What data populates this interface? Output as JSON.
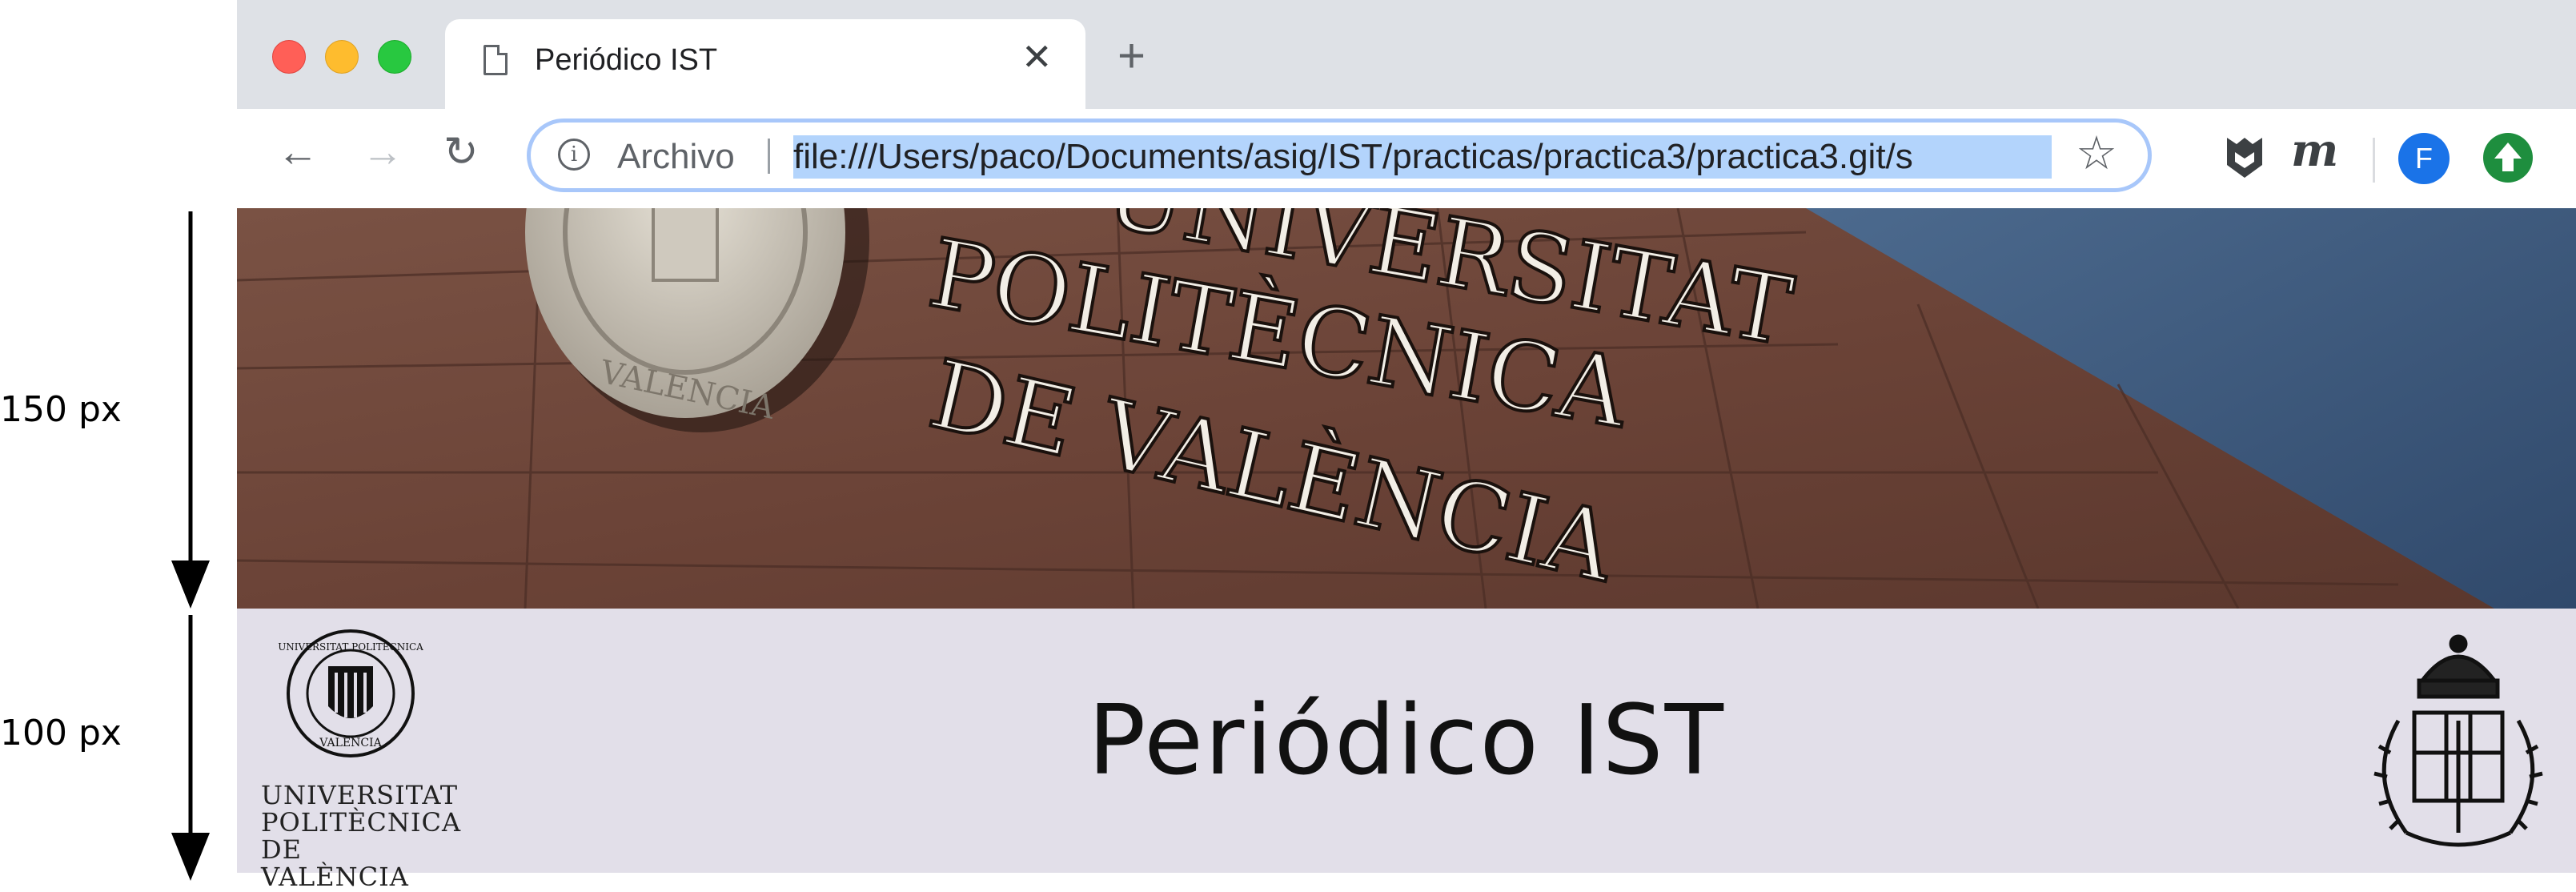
{
  "annotations": {
    "banner_height": "150 px",
    "header_height": "100 px"
  },
  "browser": {
    "tab_title": "Periódico IST",
    "tab_close": "✕",
    "new_tab": "+",
    "back": "←",
    "forward": "→",
    "reload": "↻",
    "info": "i",
    "scheme_label": "Archivo",
    "url": "file:///Users/paco/Documents/asig/IST/practicas/practica3/practica3.git/s",
    "bookmark": "☆",
    "ext_m": "m",
    "avatar_initial": "F",
    "colors": {
      "close": "#ff5f57",
      "minimize": "#febc2e",
      "zoom": "#28c840",
      "selection": "#b3d4fc"
    }
  },
  "banner": {
    "sign_line1": "UNIVERSITAT",
    "sign_line2": "POLITÈCNICA",
    "sign_line3": "DE VALÈNCIA",
    "seal_text": "VALENCIA"
  },
  "header": {
    "title": "Periódico IST",
    "logo_left_line1": "UNIVERSITAT",
    "logo_left_line2": "POLITÈCNICA",
    "logo_left_line3": "DE VALÈNCIA",
    "seal_small_top": "UNIVERSITAT POLITÈCNICA",
    "seal_small_bottom": "VALENCIA"
  }
}
